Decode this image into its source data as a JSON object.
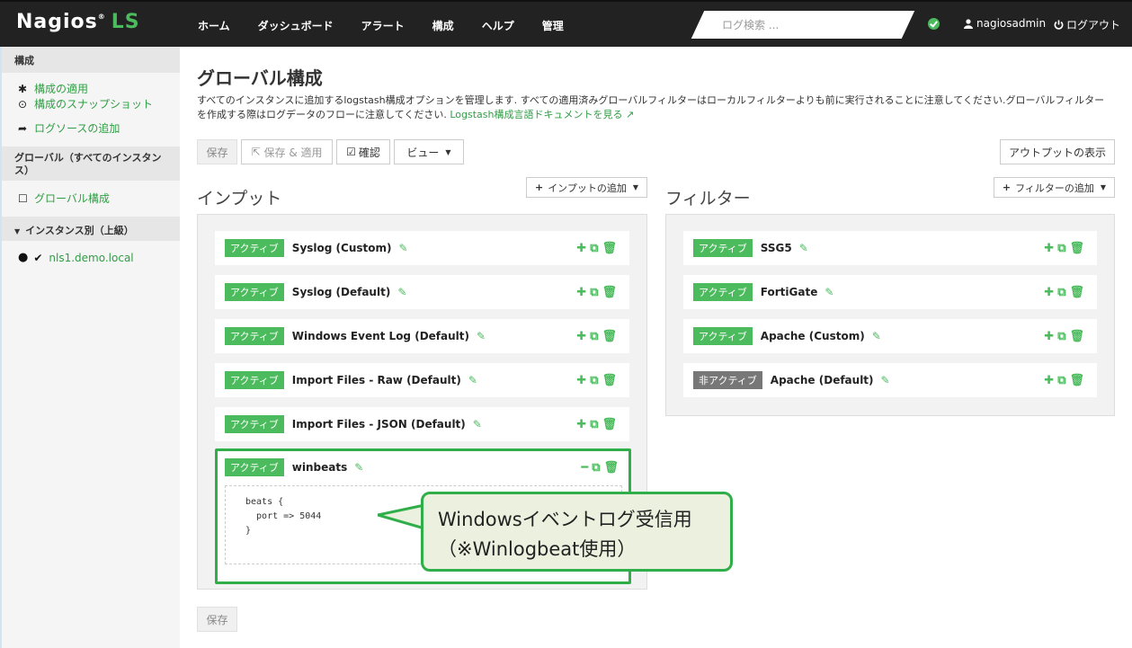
{
  "brand": {
    "name": "Nagios",
    "suffix": "LS",
    "reg": "®"
  },
  "nav": [
    "ホーム",
    "ダッシュボード",
    "アラート",
    "構成",
    "ヘルプ",
    "管理"
  ],
  "search": {
    "placeholder": "ログ検索 ..."
  },
  "user": {
    "name": "nagiosadmin",
    "logout": "ログアウト"
  },
  "sidebar": {
    "section1": "構成",
    "apply": "構成の適用",
    "snapshot": "構成のスナップショット",
    "add_source": "ログソースの追加",
    "section2": "グローバル（すべてのインスタンス）",
    "global_config": "グローバル構成",
    "section3": "インスタンス別（上級）",
    "instance": "nls1.demo.local"
  },
  "page": {
    "title": "グローバル構成",
    "desc": "すべてのインスタンスに追加するlogstash構成オプションを管理します. すべての適用済みグローバルフィルターはローカルフィルターよりも前に実行されることに注意してください.グローバルフィルターを作成する際はログデータのフローに注意してください.",
    "desc_link": "Logstash構成言語ドキュメントを見る"
  },
  "toolbar": {
    "save": "保存",
    "save_apply": "保存 & 適用",
    "verify": "確認",
    "view": "ビュー",
    "show_output": "アウトプットの表示"
  },
  "inputs": {
    "title": "インプット",
    "add": "インプットの追加",
    "items": [
      {
        "status": "アクティブ",
        "name": "Syslog (Custom)"
      },
      {
        "status": "アクティブ",
        "name": "Syslog (Default)"
      },
      {
        "status": "アクティブ",
        "name": "Windows Event Log (Default)"
      },
      {
        "status": "アクティブ",
        "name": "Import Files - Raw (Default)"
      },
      {
        "status": "アクティブ",
        "name": "Import Files - JSON (Default)"
      }
    ],
    "expanded": {
      "status": "アクティブ",
      "name": "winbeats",
      "code": "beats {\n  port => 5044\n}"
    }
  },
  "filters": {
    "title": "フィルター",
    "add": "フィルターの追加",
    "items": [
      {
        "status": "アクティブ",
        "name": "SSG5"
      },
      {
        "status": "アクティブ",
        "name": "FortiGate"
      },
      {
        "status": "アクティブ",
        "name": "Apache (Custom)"
      },
      {
        "status": "非アクティブ",
        "name": "Apache (Default)"
      }
    ]
  },
  "footer": {
    "save": "保存"
  },
  "callout": {
    "line1": "Windowsイベントログ受信用",
    "line2": "（※Winlogbeat使用）"
  },
  "colors": {
    "accent": "#4cbb5e",
    "topbar": "#222222",
    "inactive": "#777777"
  }
}
